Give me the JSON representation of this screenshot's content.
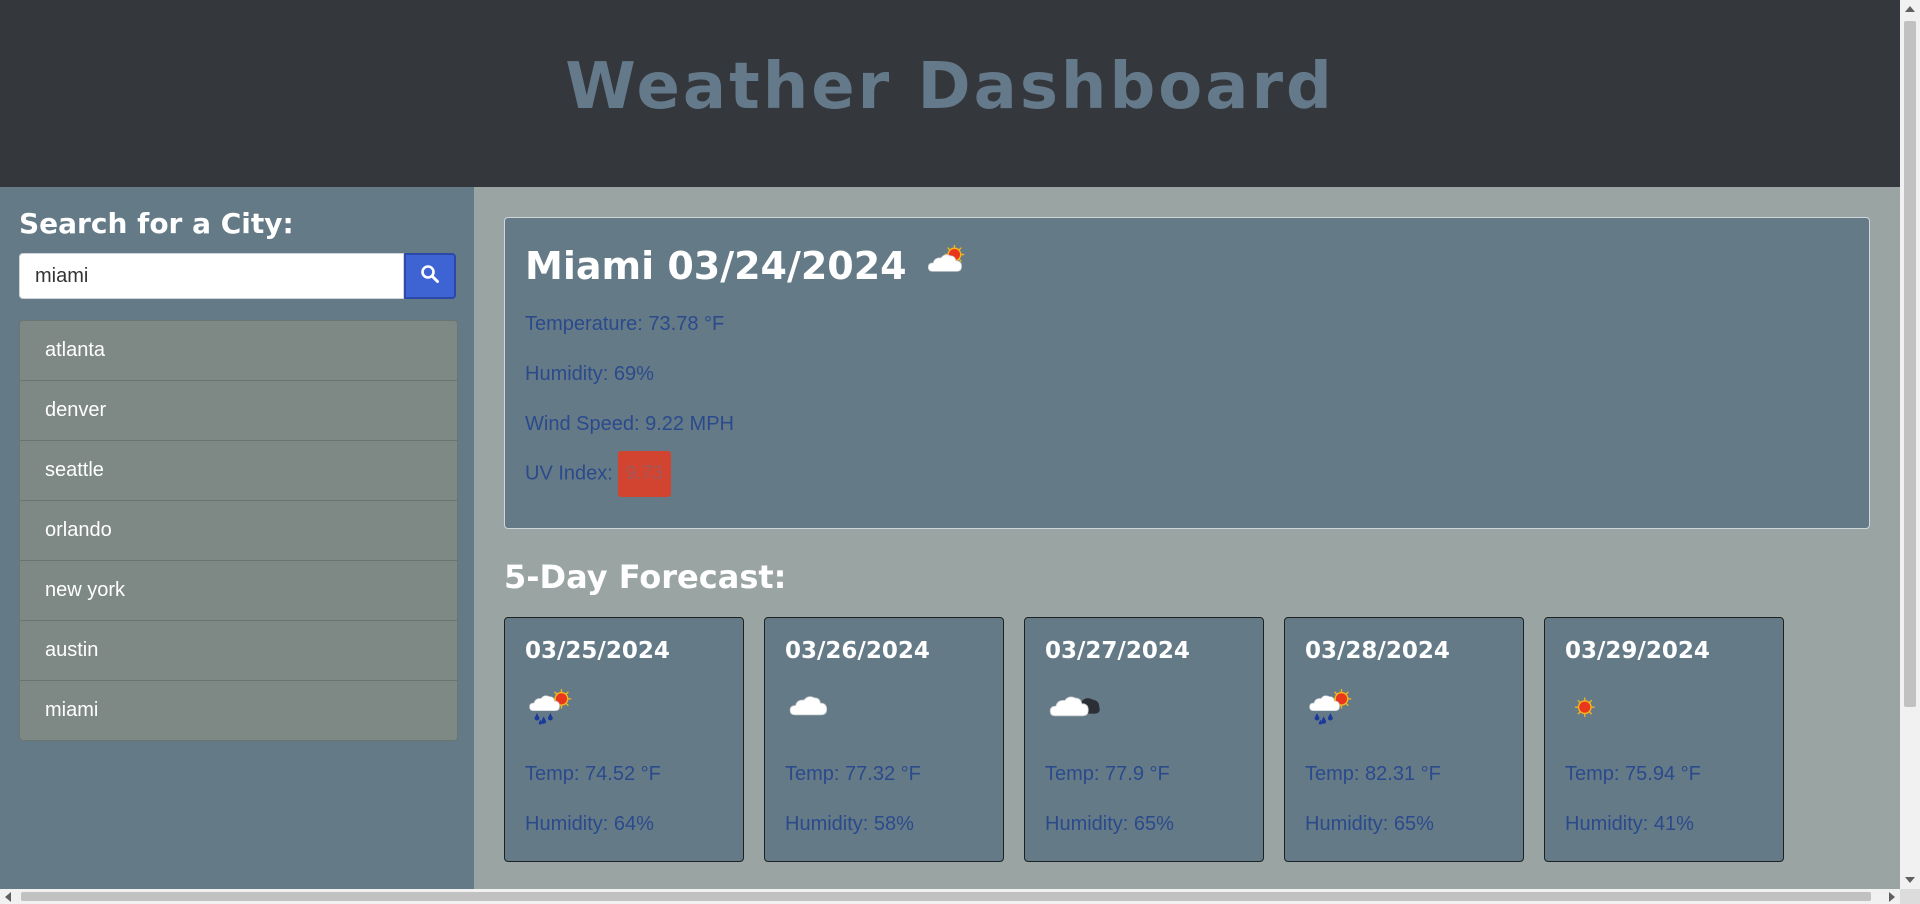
{
  "header": {
    "title": "Weather Dashboard"
  },
  "sidebar": {
    "title": "Search for a City:",
    "search_value": "miami",
    "search_icon": "search-icon",
    "history": [
      {
        "label": "atlanta"
      },
      {
        "label": "denver"
      },
      {
        "label": "seattle"
      },
      {
        "label": "orlando"
      },
      {
        "label": "new york"
      },
      {
        "label": "austin"
      },
      {
        "label": "miami"
      }
    ]
  },
  "current": {
    "title": "Miami 03/24/2024",
    "icon": "partly-cloudy-sun-icon",
    "temperature": "Temperature: 73.78 °F",
    "humidity": "Humidity: 69%",
    "wind": "Wind Speed: 9.22 MPH",
    "uv_label": "UV Index:",
    "uv_value": "9.73",
    "uv_color": "#d2442f"
  },
  "forecast": {
    "title": "5-Day Forecast:",
    "days": [
      {
        "date": "03/25/2024",
        "icon": "rain-sun-icon",
        "temp": "Temp: 74.52 °F",
        "humidity": "Humidity: 64%"
      },
      {
        "date": "03/26/2024",
        "icon": "cloud-icon",
        "temp": "Temp: 77.32 °F",
        "humidity": "Humidity: 58%"
      },
      {
        "date": "03/27/2024",
        "icon": "broken-clouds-icon",
        "temp": "Temp: 77.9 °F",
        "humidity": "Humidity: 65%"
      },
      {
        "date": "03/28/2024",
        "icon": "rain-sun-icon",
        "temp": "Temp: 82.31 °F",
        "humidity": "Humidity: 65%"
      },
      {
        "date": "03/29/2024",
        "icon": "sun-icon",
        "temp": "Temp: 75.94 °F",
        "humidity": "Humidity: 41%"
      }
    ]
  },
  "colors": {
    "header_bg": "#34373c",
    "title": "#64798a",
    "panel": "#647a87",
    "page_bg": "#9aa5a3",
    "search_button": "#3e64d4",
    "stat_text": "#2b4a8c"
  }
}
